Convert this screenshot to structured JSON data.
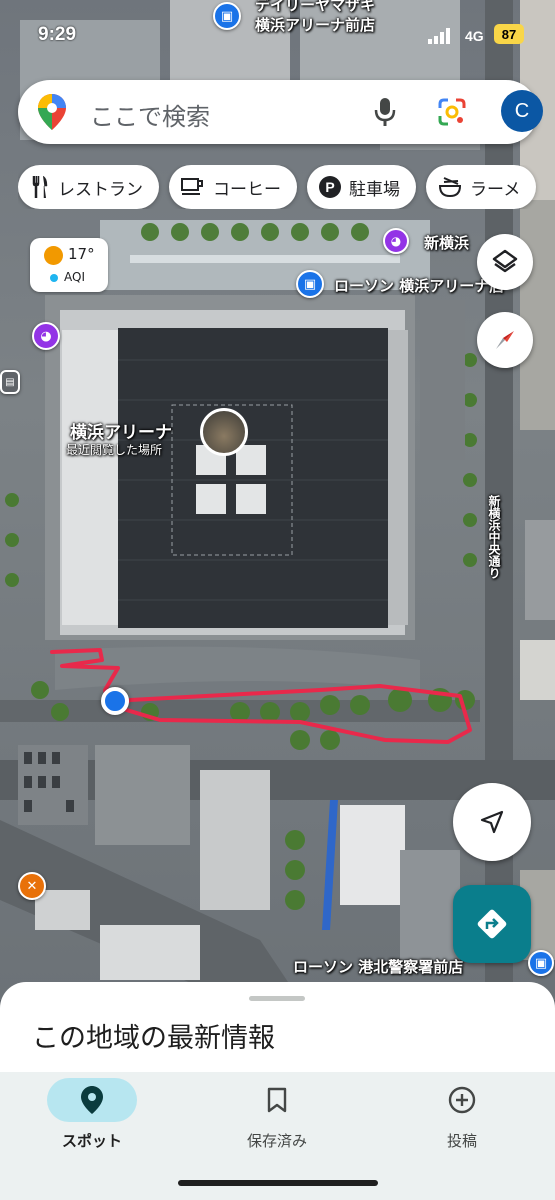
{
  "status_bar": {
    "time": "9:29",
    "network": "4G",
    "battery": "87"
  },
  "search": {
    "placeholder": "ここで検索",
    "avatar_letter": "C"
  },
  "chips": [
    {
      "icon": "restaurant-icon",
      "label": "レストラン"
    },
    {
      "icon": "coffee-icon",
      "label": "コーヒー"
    },
    {
      "icon": "parking-icon",
      "label": "駐車場"
    },
    {
      "icon": "ramen-icon",
      "label": "ラーメ"
    }
  ],
  "weather": {
    "temperature": "17°",
    "aqi_label": "AQI"
  },
  "map_labels": {
    "top_store": "デイリーヤマザキ\n横浜アリーナ前店",
    "top_store_line1": "デイリーヤマザキ",
    "top_store_line2": "横浜アリーナ前店",
    "shin_yokohama": "新横浜",
    "lawson_arena": "ローソン 横浜アリーナ店",
    "arena_name": "横浜アリーナ",
    "arena_sub": "最近閲覧した場所",
    "street_vertical": "新横浜中央通り",
    "lawson_police": "ローソン 港北警察署前店"
  },
  "sheet": {
    "heading": "この地域の最新情報"
  },
  "bottom_nav": [
    {
      "icon": "pin-icon",
      "label": "スポット",
      "active": true
    },
    {
      "icon": "bookmark-icon",
      "label": "保存済み",
      "active": false
    },
    {
      "icon": "plus-circle-icon",
      "label": "投稿",
      "active": false
    }
  ],
  "colors": {
    "accent": "#0a7e8c",
    "route": "#e8294b",
    "location": "#1a73e8",
    "avatar": "#0b57a4"
  }
}
